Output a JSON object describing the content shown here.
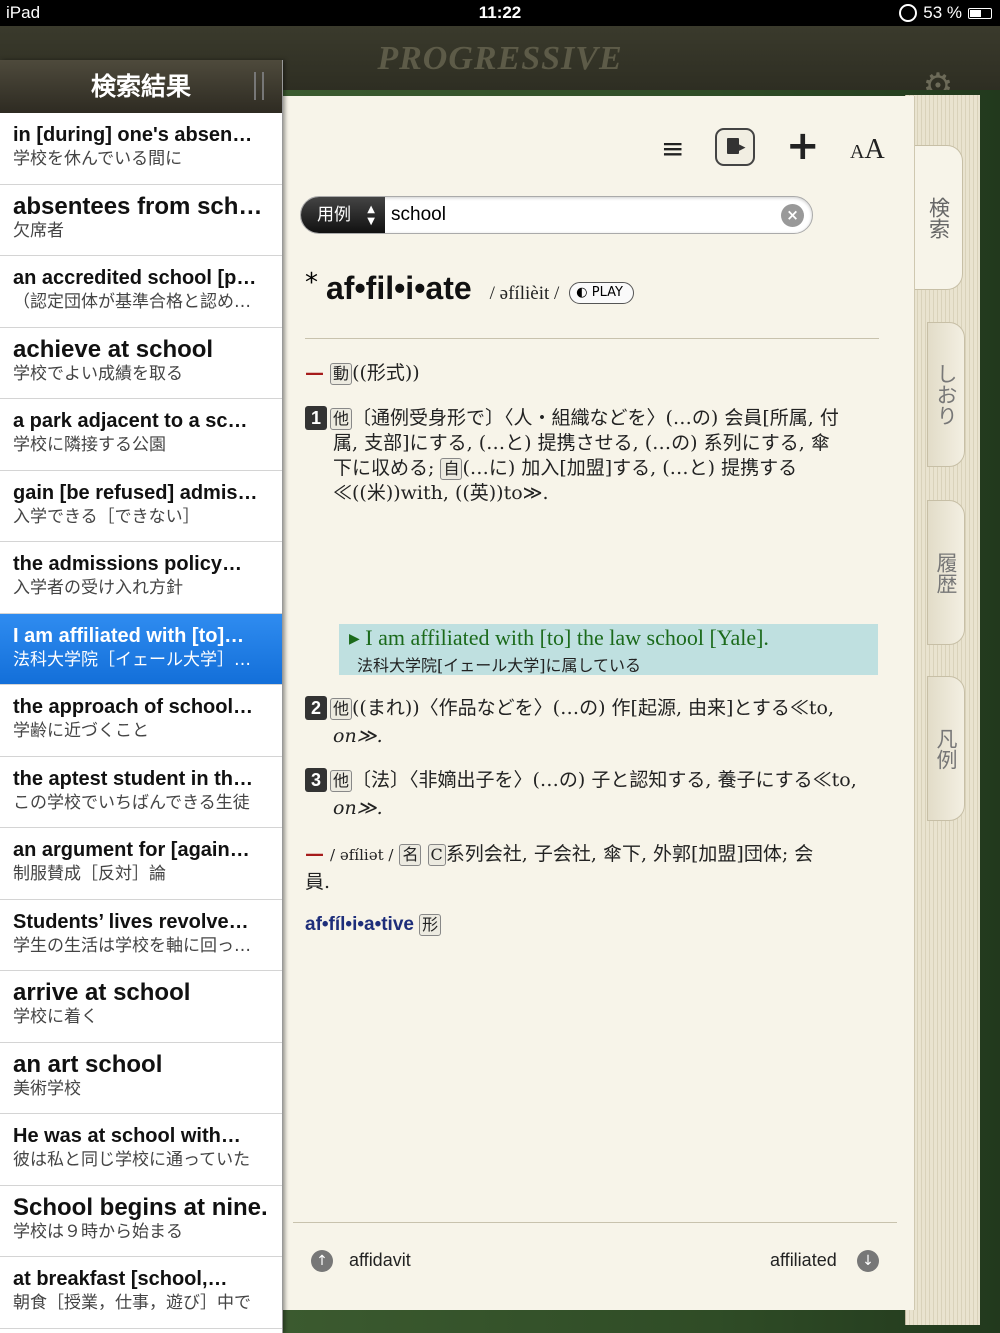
{
  "status_bar": {
    "device": "iPad",
    "time": "11:22",
    "battery": "53 %"
  },
  "app": {
    "brand": "PROGRESSIVE"
  },
  "sidebar": {
    "title": "検索結果",
    "results": [
      {
        "en": "in [during] one's absen…",
        "ja": "学校を休んでいる間に",
        "big": false,
        "selected": false
      },
      {
        "en": "absentees from school",
        "ja": "欠席者",
        "big": true,
        "selected": false
      },
      {
        "en": "an accredited school [p…",
        "ja": "（認定団体が基準合格と認め…",
        "big": false,
        "selected": false
      },
      {
        "en": "achieve at school",
        "ja": "学校でよい成績を取る",
        "big": true,
        "selected": false
      },
      {
        "en": "a park adjacent to a sc…",
        "ja": "学校に隣接する公園",
        "big": false,
        "selected": false
      },
      {
        "en": "gain [be refused] admis…",
        "ja": "入学できる［できない］",
        "big": false,
        "selected": false
      },
      {
        "en": "the admissions policy…",
        "ja": "入学者の受け入れ方針",
        "big": false,
        "selected": false
      },
      {
        "en": "I am affiliated with [to]…",
        "ja": "法科大学院［イェール大学］…",
        "big": false,
        "selected": true
      },
      {
        "en": "the approach of school…",
        "ja": "学齢に近づくこと",
        "big": false,
        "selected": false
      },
      {
        "en": "the aptest student in th…",
        "ja": "この学校でいちばんできる生徒",
        "big": false,
        "selected": false
      },
      {
        "en": "an argument for [again…",
        "ja": "制服賛成［反対］論",
        "big": false,
        "selected": false
      },
      {
        "en": "Students’ lives revolve…",
        "ja": "学生の生活は学校を軸に回っ…",
        "big": false,
        "selected": false
      },
      {
        "en": "arrive at school",
        "ja": "学校に着く",
        "big": true,
        "selected": false
      },
      {
        "en": "an art school",
        "ja": "美術学校",
        "big": true,
        "selected": false
      },
      {
        "en": "He was at school with…",
        "ja": "彼は私と同じ学校に通っていた",
        "big": false,
        "selected": false
      },
      {
        "en": "School begins at nine.",
        "ja": "学校は９時から始まる",
        "big": true,
        "selected": false
      },
      {
        "en": "at breakfast [school,…",
        "ja": "朝食［授業，仕事，遊び］中で",
        "big": false,
        "selected": false
      }
    ]
  },
  "toolbar": {
    "list_icon": "≡",
    "plus_icon": "+",
    "font_label_small": "A",
    "font_label_big": "A"
  },
  "search": {
    "scope": "用例",
    "value": "school",
    "clear": "×"
  },
  "entry": {
    "asterisk": "*",
    "headword": "af•fil•i•ate",
    "pronunciation": "/ əfílièit /",
    "play": "PLAY",
    "pos_line": {
      "dash": "—",
      "pos": "動",
      "note": "((形式))"
    },
    "senses": [
      {
        "num": "1",
        "tag": "他",
        "lines": [
          "〔通例受身形で〕〈人・組織などを〉(…の) 会員[所属, 付",
          "属, 支部]にする, (…と) 提携させる, (…の) 系列にする, 傘",
          "下に収める;",
          "(…に) 加入[加盟]する, (…と) 提携する",
          "≪((米))with, ((英))to≫."
        ],
        "inline_tag": "自"
      },
      {
        "num": "2",
        "tag": "他",
        "lines": [
          "((まれ))〈作品などを〉(…の) 作[起源, 由来]とする≪to,",
          "on≫."
        ]
      },
      {
        "num": "3",
        "tag": "他",
        "lines": [
          "〔法〕〈非嫡出子を〉(…の) 子と認知する, 養子にする≪to,",
          "on≫."
        ]
      }
    ],
    "example": {
      "marker": "▶",
      "en": "I am affiliated with [to] the law school [Yale].",
      "ja": "法科大学院[イェール大学]に属している"
    },
    "noun_line": {
      "dash": "—",
      "pron": "/ əfíliət /",
      "pos": "名",
      "count": "C",
      "text": "系列会社, 子会社, 傘下, 外郭[加盟]団体; 会",
      "text2": "員."
    },
    "derivative": {
      "word": "af•fíl•i•a•tive",
      "pos": "形"
    }
  },
  "footer": {
    "prev": "affidavit",
    "next": "affiliated",
    "prev_arrow": "↑",
    "next_arrow": "↓"
  },
  "tabs": [
    {
      "label": "検索",
      "active": true
    },
    {
      "label": "しおり",
      "active": false
    },
    {
      "label": "履歴",
      "active": false
    },
    {
      "label": "凡例",
      "active": false
    }
  ]
}
